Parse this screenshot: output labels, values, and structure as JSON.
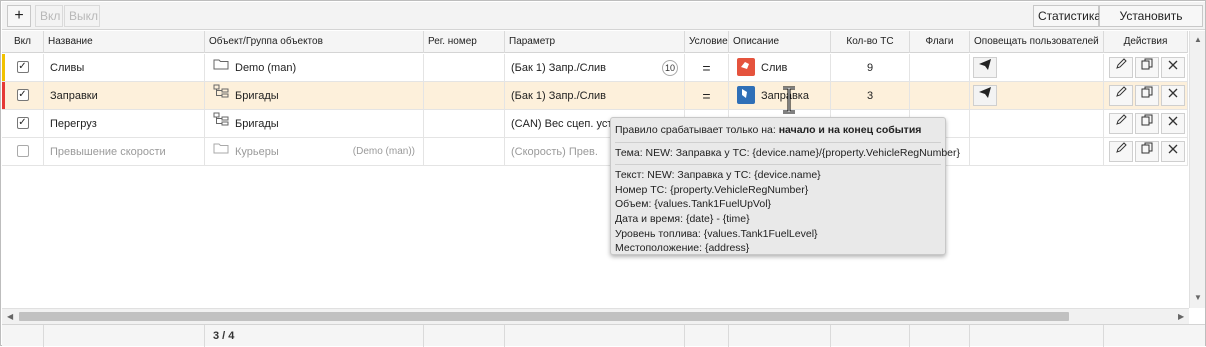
{
  "toolbar": {
    "add_label": "+",
    "enable_label": "Вкл",
    "disable_label": "Выкл",
    "stats_label": "Статистика",
    "limits_label": "Установить лимиты"
  },
  "columns": {
    "enabled": "Вкл",
    "name": "Название",
    "object": "Объект/Группа объектов",
    "reg_number": "Рег. номер",
    "parameter": "Параметр",
    "condition": "Условие",
    "description": "Описание",
    "vehicle_count": "Кол-во ТС",
    "flags": "Флаги",
    "notify": "Оповещать пользователей",
    "actions": "Действия"
  },
  "rows": [
    {
      "checked": "✓",
      "name": "Сливы",
      "object": "Demo (man)",
      "parameter": "(Бак 1) Запр./Слив",
      "param_badge": "10",
      "condition": "=",
      "description": "Слив",
      "vehicle_count": "9",
      "marker_color": "#f2c200"
    },
    {
      "checked": "✓",
      "name": "Заправки",
      "object": "Бригады",
      "parameter": "(Бак 1) Запр./Слив",
      "condition": "=",
      "description": "Заправка",
      "vehicle_count": "3",
      "marker_color": "#e53935"
    },
    {
      "checked": "✓",
      "name": "Перегруз",
      "object": "Бригады",
      "parameter": "(CAN) Вес сцеп. устр"
    },
    {
      "checked": "",
      "name": "Превышение скорости",
      "object": "Курьеры",
      "object_sub": "(Demo (man))",
      "parameter": "(Скорость) Прев."
    }
  ],
  "footer": {
    "count": "3 / 4"
  },
  "tooltip": {
    "trigger_prefix": "Правило срабатывает только на:",
    "trigger_value": "начало и на конец события",
    "subject": "Тема: NEW: Заправка у ТС: {device.name}/{property.VehicleRegNumber}",
    "lines": [
      "Текст: NEW: Заправка у ТС: {device.name}",
      "Номер ТС: {property.VehicleRegNumber}",
      "Объем: {values.Tank1FuelUpVol}",
      "Дата и время: {date} - {time}",
      "Уровень топлива: {values.Tank1FuelLevel}",
      "Местоположение: {address}"
    ]
  },
  "colors": {
    "selected_row": "#fdf0db",
    "drain_icon": "#e5533d",
    "refuel_icon": "#2f6fb7"
  },
  "icons": [
    "folder-icon",
    "group-tree-icon",
    "send-icon",
    "edit-icon",
    "copy-icon",
    "close-icon",
    "text-cursor-icon"
  ]
}
